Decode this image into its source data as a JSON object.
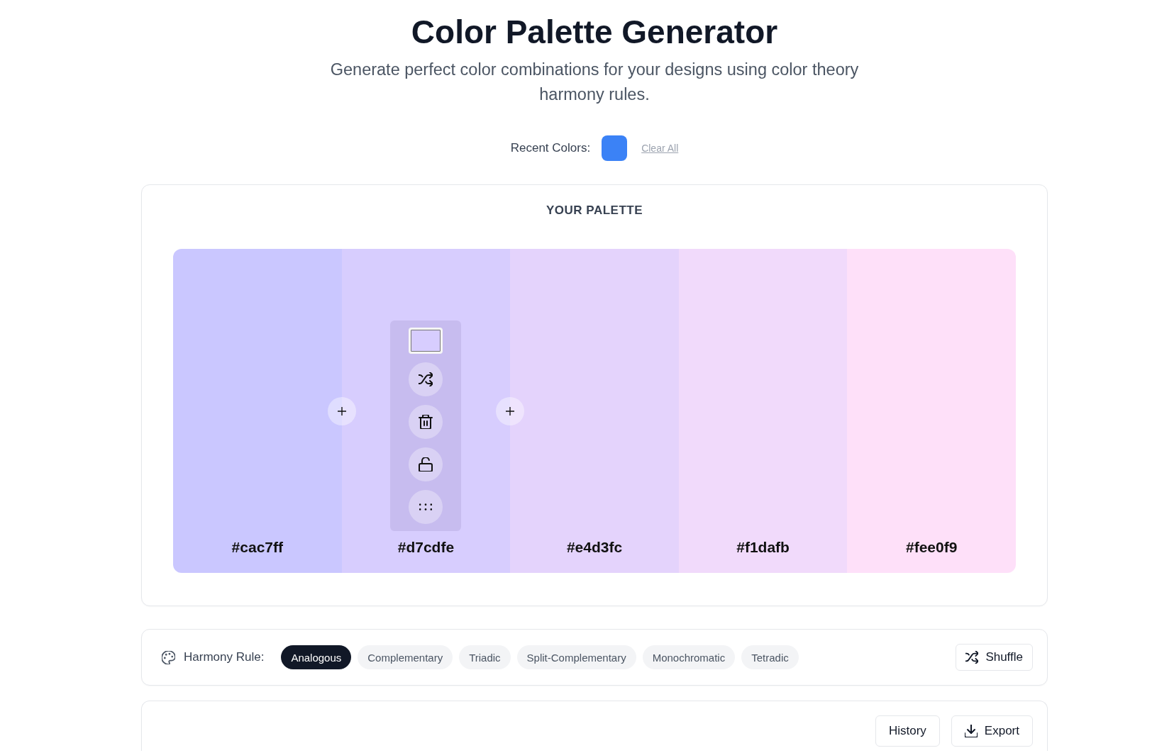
{
  "header": {
    "title": "Color Palette Generator",
    "subtitle": "Generate perfect color combinations for your designs using color theory harmony rules."
  },
  "recent_colors": {
    "label": "Recent Colors:",
    "swatches": [
      {
        "color": "#3b82f6"
      }
    ],
    "clear_link": "Clear All"
  },
  "palette": {
    "title": "YOUR PALETTE",
    "swatches": [
      {
        "hex": "#cac7ff",
        "color": "#cac7ff"
      },
      {
        "hex": "#d7cdfe",
        "color": "#d7cdfe",
        "toolbar": {
          "locked": false
        }
      },
      {
        "hex": "#e4d3fc",
        "color": "#e4d3fc"
      },
      {
        "hex": "#f1dafb",
        "color": "#f1dafb"
      },
      {
        "hex": "#fee0f9",
        "color": "#fee0f9"
      }
    ]
  },
  "harmony": {
    "label": "Harmony Rule:",
    "rules": [
      {
        "label": "Analogous",
        "selected": true
      },
      {
        "label": "Complementary",
        "selected": false
      },
      {
        "label": "Triadic",
        "selected": false
      },
      {
        "label": "Split-Complementary",
        "selected": false
      },
      {
        "label": "Monochromatic",
        "selected": false
      },
      {
        "label": "Tetradic",
        "selected": false
      }
    ],
    "shuffle_button": "Shuffle"
  },
  "actions": {
    "buttons": [
      {
        "label": "History",
        "kind": "plain"
      },
      {
        "label": "Export",
        "kind": "download"
      }
    ]
  }
}
